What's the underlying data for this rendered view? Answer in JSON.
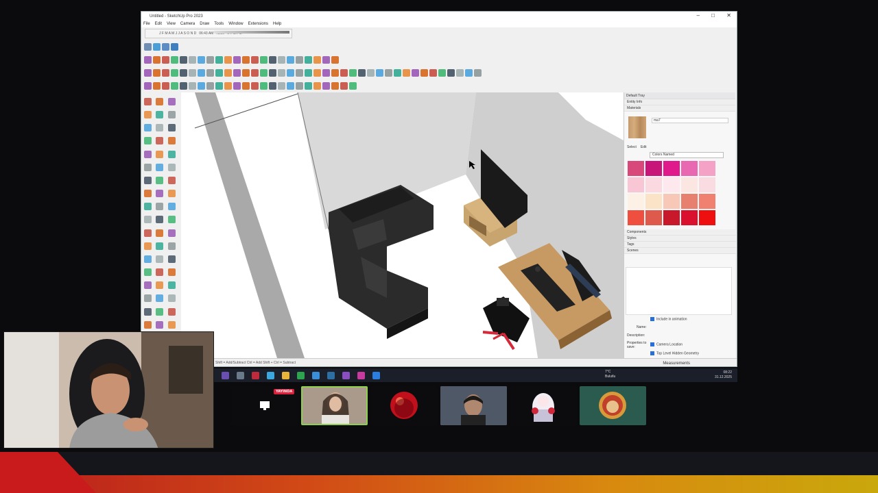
{
  "window": {
    "title": "Untitled - SketchUp Pro 2023",
    "controls": [
      "–",
      "□",
      "✕"
    ]
  },
  "menu": [
    "File",
    "Edit",
    "View",
    "Camera",
    "Draw",
    "Tools",
    "Window",
    "Extensions",
    "Help"
  ],
  "shadows": {
    "months": "J F M A M J J A S O N D",
    "time_start": "06:43 AM",
    "noon": "Noon",
    "time_end": "04:45 PM"
  },
  "status_hint": "Shift = Add/Subtract  Ctrl = Add  Shift + Ctrl = Subtract",
  "measurements_label": "Measurements",
  "tray": {
    "title": "Default Tray",
    "entity_info": "Entity Info",
    "materials": "Materials",
    "material_name": "ma7",
    "select_tab": "Select",
    "edit_tab": "Edit",
    "library": "Colors Named",
    "swatch_colors": [
      "#d9487a",
      "#c8157a",
      "#e01a8b",
      "#e968b2",
      "#f4a3c6",
      "#f8c6d4",
      "#fbd9e1",
      "#fde8ee",
      "#fce6e1",
      "#f9dce2",
      "#fdf1e6",
      "#fbe3c8",
      "#f7c8b8",
      "#e7806f",
      "#f08070",
      "#ee4f3f",
      "#de5a4d",
      "#c7182c",
      "#d9102e",
      "#ee1010"
    ],
    "components": "Components",
    "styles": "Styles",
    "tags": "Tags",
    "scenes": "Scenes",
    "include_in_animation": "Include in animation",
    "name_label": "Name:",
    "description_label": "Description:",
    "properties_label": "Properties to save:",
    "camera_location": "Camera Location",
    "top_level_geometry": "Top Level Hidden Geometry"
  },
  "taskbar": {
    "weather_temp": "7°C",
    "weather_desc": "Bulutlu",
    "time": "08:22",
    "date": "31.12.2025"
  },
  "stream": {
    "live_badge": "YAYINDA"
  },
  "colors": {
    "accent": "#e0203a",
    "brand_red": "#c91b1b",
    "brand_orange": "#d88a0f"
  }
}
